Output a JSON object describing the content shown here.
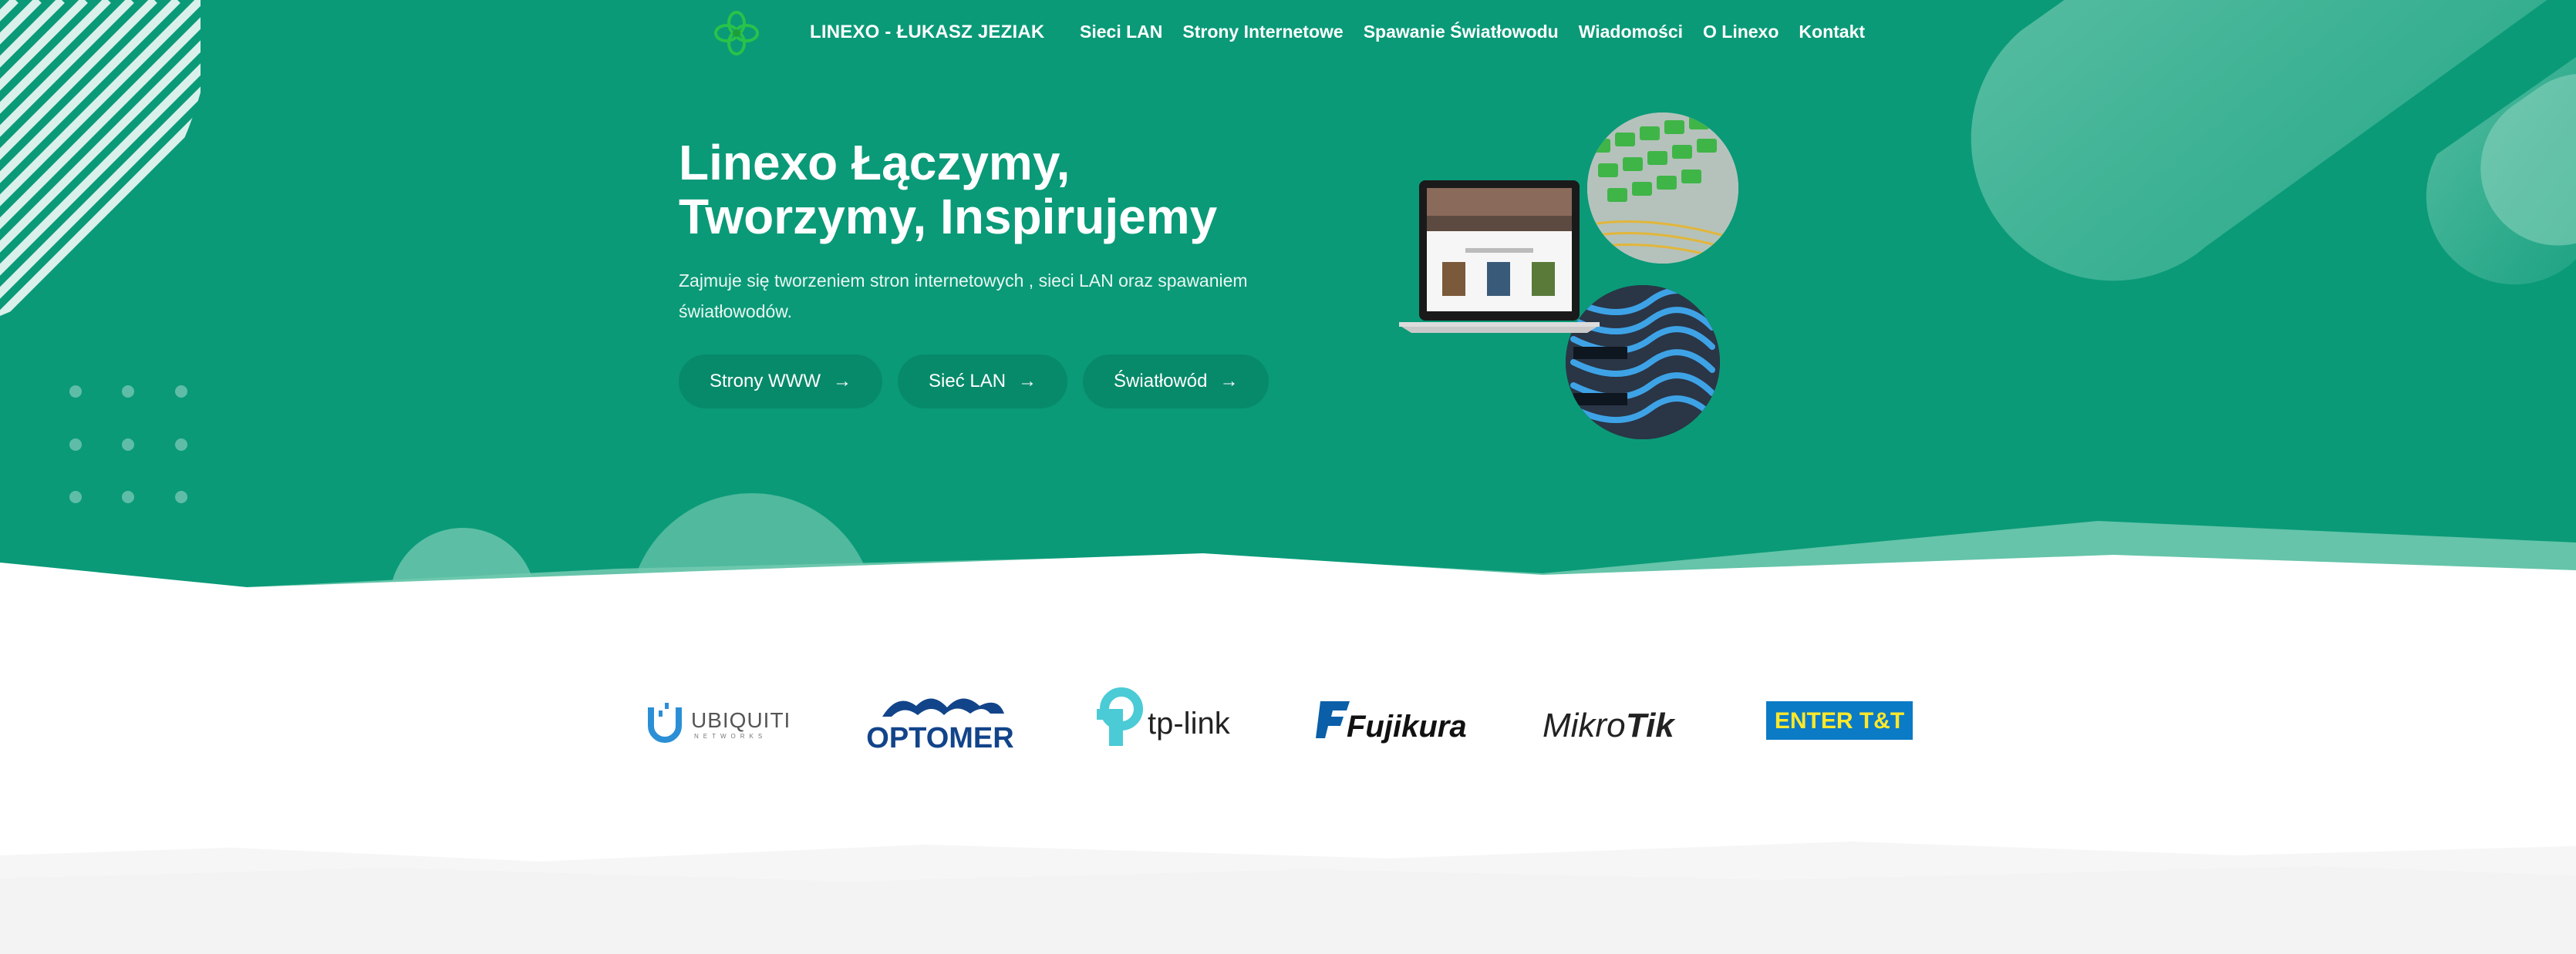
{
  "brand": {
    "name": "LINEXO - ŁUKASZ JEZIAK",
    "logo_icon": "clover-logo-icon"
  },
  "nav": {
    "items": [
      {
        "label": "Sieci LAN"
      },
      {
        "label": "Strony Internetowe"
      },
      {
        "label": "Spawanie Światłowodu"
      },
      {
        "label": "Wiadomości"
      },
      {
        "label": "O Linexo"
      },
      {
        "label": "Kontakt"
      }
    ]
  },
  "hero": {
    "title_line1": "Linexo Łączymy,",
    "title_line2": "Tworzymy, Inspirujemy",
    "lead_line1": "Zajmuje się tworzeniem stron internetowych , sieci LAN oraz spawaniem",
    "lead_line2": "światłowodów.",
    "buttons": [
      {
        "label": "Strony WWW",
        "icon": "arrow-right-icon"
      },
      {
        "label": "Sieć LAN",
        "icon": "arrow-right-icon"
      },
      {
        "label": "Światłowód",
        "icon": "arrow-right-icon"
      }
    ]
  },
  "partners": {
    "logos": [
      {
        "text": "UBIQUITI",
        "subtext": "NETWORKS"
      },
      {
        "text": "OPTOMER"
      },
      {
        "text": "tp-link"
      },
      {
        "text": "Fujikura"
      },
      {
        "text_a": "Mikro",
        "text_b": "Tik"
      },
      {
        "text": "ENTER T&T"
      }
    ]
  },
  "colors": {
    "hero_bg": "#0a9a78",
    "button_bg": "#078a6a",
    "optomer_blue": "#12448a",
    "tplink_teal": "#4acbd6",
    "fujikura_blue": "#0a5fa8",
    "enter_bg": "#0b7bc6",
    "enter_text": "#ffe82a"
  }
}
